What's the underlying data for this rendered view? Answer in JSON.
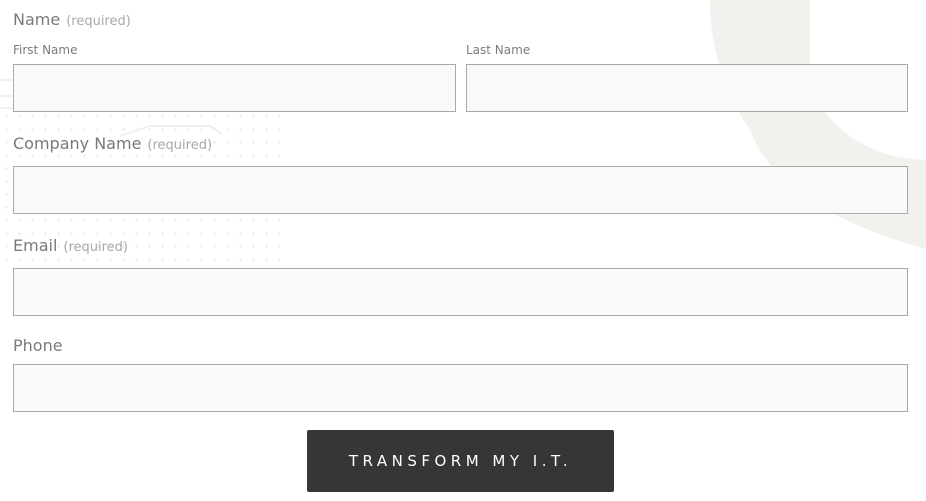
{
  "colors": {
    "field_bg": "#f9f9f9",
    "field_border": "#a9a9a9",
    "label": "#7a7a7a",
    "button_bg": "#363636",
    "button_text": "#ffffff",
    "deco": "#f1f2ee"
  },
  "form": {
    "name": {
      "label": "Name",
      "required": "(required)",
      "first": {
        "label": "First Name",
        "value": "",
        "placeholder": ""
      },
      "last": {
        "label": "Last Name",
        "value": "",
        "placeholder": ""
      }
    },
    "company": {
      "label": "Company Name",
      "required": "(required)",
      "value": "",
      "placeholder": ""
    },
    "email": {
      "label": "Email",
      "required": "(required)",
      "value": "",
      "placeholder": ""
    },
    "phone": {
      "label": "Phone",
      "value": "",
      "placeholder": ""
    },
    "submit_label": "TRANSFORM MY I.T."
  }
}
